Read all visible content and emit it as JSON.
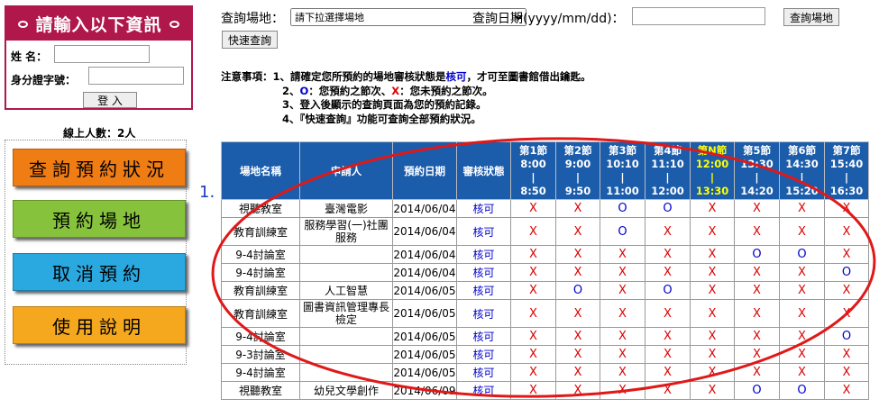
{
  "login": {
    "title": "請輸入以下資訊",
    "name_label": "姓 名：",
    "id_label": "身分證字號：",
    "submit_label": "登 入"
  },
  "online_count": "線上人數：2人",
  "menu": [
    {
      "label": "查詢預約狀況",
      "color": "#f07c14"
    },
    {
      "label": "預約場地",
      "color": "#86c23c"
    },
    {
      "label": "取消預約",
      "color": "#2aa9e0"
    },
    {
      "label": "使用說明",
      "color": "#f5a81e"
    }
  ],
  "search": {
    "venue_label": "查詢場地：",
    "venue_selected": "請下拉選擇場地",
    "date_label": "查詢日期(yyyy/mm/dd)：",
    "search_button": "查詢場地",
    "quick_button": "快速查詢"
  },
  "notes": {
    "heading": "注意事項：",
    "line1_a": "1、請確定您所預約的場地審核狀態是",
    "line1_b": "核可",
    "line1_c": "，才可至圖書館借出鑰匙。",
    "line2_a": "2、",
    "line2_o": "O",
    "line2_b": "：您預約之節次、",
    "line2_x": "X",
    "line2_c": "：您未預約之節次。",
    "line3": "3、登入後顯示的查詢頁面為您的預約記錄。",
    "line4": "4、『快速查詢』功能可查詢全部預約狀況。"
  },
  "table": {
    "headers": {
      "venue": "場地名稱",
      "applicant": "申請人",
      "date": "預約日期",
      "status": "審核狀態"
    },
    "periods": [
      {
        "name": "第1節",
        "start": "8:00",
        "end": "8:50"
      },
      {
        "name": "第2節",
        "start": "9:00",
        "end": "9:50"
      },
      {
        "name": "第3節",
        "start": "10:10",
        "end": "11:00"
      },
      {
        "name": "第4節",
        "start": "11:10",
        "end": "12:00"
      },
      {
        "name": "第N節",
        "start": "12:00",
        "end": "13:30"
      },
      {
        "name": "第5節",
        "start": "13:30",
        "end": "14:20"
      },
      {
        "name": "第6節",
        "start": "14:30",
        "end": "15:20"
      },
      {
        "name": "第7節",
        "start": "15:40",
        "end": "16:30"
      }
    ],
    "sep": "|",
    "rows": [
      {
        "venue": "視聽教室",
        "applicant": "臺灣電影",
        "date": "2014/06/04",
        "status": "核可",
        "slots": [
          "X",
          "X",
          "O",
          "O",
          "X",
          "X",
          "X",
          "X"
        ]
      },
      {
        "venue": "教育訓練室",
        "applicant": "服務學習(一)社團服務",
        "date": "2014/06/04",
        "status": "核可",
        "slots": [
          "X",
          "X",
          "O",
          "X",
          "X",
          "X",
          "X",
          "X"
        ]
      },
      {
        "venue": "9-4討論室",
        "applicant": "",
        "date": "2014/06/04",
        "status": "核可",
        "slots": [
          "X",
          "X",
          "X",
          "X",
          "X",
          "O",
          "O",
          "X"
        ]
      },
      {
        "venue": "9-4討論室",
        "applicant": "",
        "date": "2014/06/04",
        "status": "核可",
        "slots": [
          "X",
          "X",
          "X",
          "X",
          "X",
          "X",
          "X",
          "O"
        ]
      },
      {
        "venue": "教育訓練室",
        "applicant": "人工智慧",
        "date": "2014/06/05",
        "status": "核可",
        "slots": [
          "X",
          "O",
          "X",
          "O",
          "X",
          "X",
          "X",
          "X"
        ]
      },
      {
        "venue": "教育訓練室",
        "applicant": "圖書資訊管理專長檢定",
        "date": "2014/06/05",
        "status": "核可",
        "slots": [
          "X",
          "X",
          "X",
          "X",
          "X",
          "X",
          "X",
          "X"
        ]
      },
      {
        "venue": "9-4討論室",
        "applicant": "",
        "date": "2014/06/05",
        "status": "核可",
        "slots": [
          "X",
          "X",
          "X",
          "X",
          "X",
          "X",
          "X",
          "O"
        ]
      },
      {
        "venue": "9-3討論室",
        "applicant": "",
        "date": "2014/06/05",
        "status": "核可",
        "slots": [
          "X",
          "X",
          "X",
          "X",
          "X",
          "X",
          "X",
          "X"
        ]
      },
      {
        "venue": "9-4討論室",
        "applicant": "",
        "date": "2014/06/05",
        "status": "核可",
        "slots": [
          "X",
          "X",
          "X",
          "X",
          "X",
          "X",
          "X",
          "X"
        ]
      },
      {
        "venue": "視聽教室",
        "applicant": "幼兒文學創作",
        "date": "2014/06/09",
        "status": "核可",
        "slots": [
          "X",
          "X",
          "X",
          "X",
          "X",
          "O",
          "O",
          "X"
        ]
      }
    ]
  },
  "annotation": "1."
}
